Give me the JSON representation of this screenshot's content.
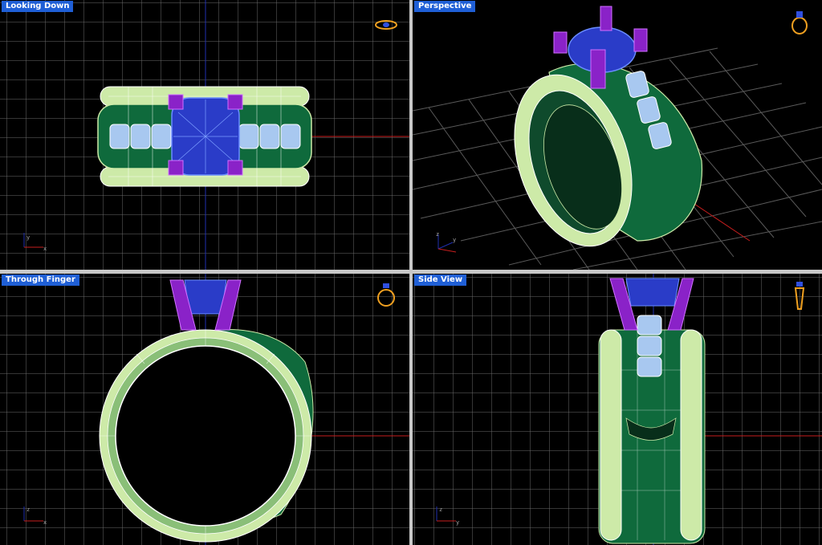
{
  "viewports": {
    "top": {
      "title": "Looking Down"
    },
    "perspective": {
      "title": "Perspective"
    },
    "front": {
      "title": "Through Finger"
    },
    "side": {
      "title": "Side View"
    }
  },
  "axis_labels": {
    "x": "x",
    "y": "y",
    "z": "z"
  },
  "colors": {
    "grid": "#6a6a6a",
    "band": "#0f6a3c",
    "band_light": "#cdeaa8",
    "gem": "#2a3cc8",
    "prong": "#8a22c8",
    "side_stone": "#a8c8f0",
    "axis_x": "#c81e1e",
    "axis_y": "#2030b0",
    "title_bg": "#1f5fd6"
  },
  "icons": {
    "top": "ring-top-icon",
    "perspective": "ring-perspective-icon",
    "front": "ring-front-icon",
    "side": "ring-side-icon"
  }
}
